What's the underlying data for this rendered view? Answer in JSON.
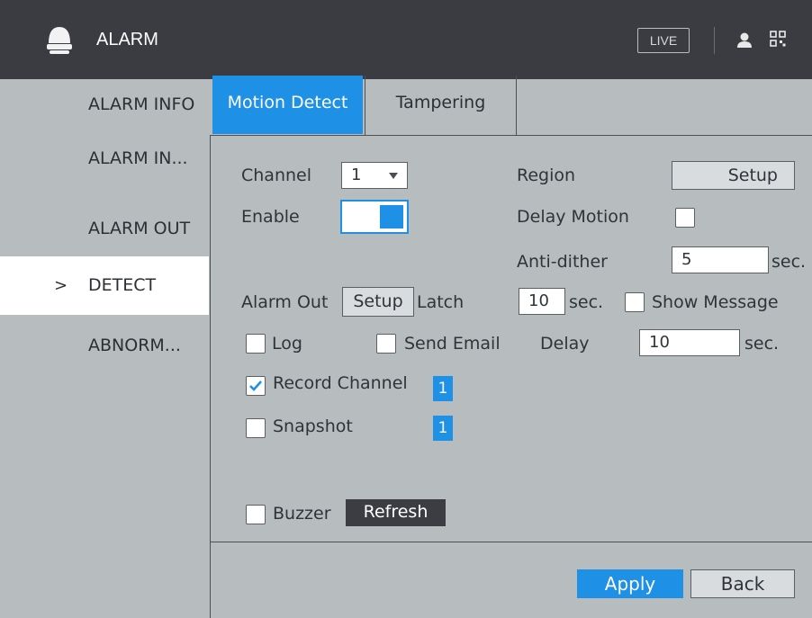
{
  "header": {
    "title": "ALARM",
    "live_label": "LIVE",
    "icons": [
      "alarm-bell-icon",
      "user-icon",
      "qr-code-icon"
    ]
  },
  "sidebar": {
    "items": [
      {
        "label": "ALARM INFO",
        "active": false
      },
      {
        "label": "ALARM IN...",
        "active": false
      },
      {
        "label": "ALARM OUT",
        "active": false
      },
      {
        "label": "DETECT",
        "active": true
      },
      {
        "label": "ABNORM...",
        "active": false
      }
    ],
    "chevron": ">"
  },
  "tabs": [
    {
      "label": "Motion Detect",
      "active": true
    },
    {
      "label": "Tampering",
      "active": false
    }
  ],
  "form": {
    "channel_label": "Channel",
    "channel_value": "1",
    "region_label": "Region",
    "region_setup": "Setup",
    "enable_label": "Enable",
    "enable_on": true,
    "delay_motion_label": "Delay Motion",
    "delay_motion_checked": false,
    "anti_dither_label": "Anti-dither",
    "anti_dither_value": "5",
    "sec": "sec.",
    "alarm_out_label": "Alarm Out",
    "alarm_out_setup": "Setup",
    "latch_label": "Latch",
    "latch_value": "10",
    "show_message_label": "Show Message",
    "show_message_checked": false,
    "log_label": "Log",
    "log_checked": false,
    "send_email_label": "Send Email",
    "send_email_checked": false,
    "delay_label": "Delay",
    "delay_value": "10",
    "record_channel_label": "Record Channel",
    "record_channel_checked": true,
    "record_channel_value": "1",
    "snapshot_label": "Snapshot",
    "snapshot_checked": false,
    "snapshot_value": "1",
    "buzzer_label": "Buzzer",
    "buzzer_checked": false,
    "refresh_label": "Refresh"
  },
  "footer": {
    "apply_label": "Apply",
    "back_label": "Back"
  },
  "colors": {
    "accent": "#1e90e6",
    "titlebar": "#3a3c41",
    "background": "#b7bcbf"
  }
}
